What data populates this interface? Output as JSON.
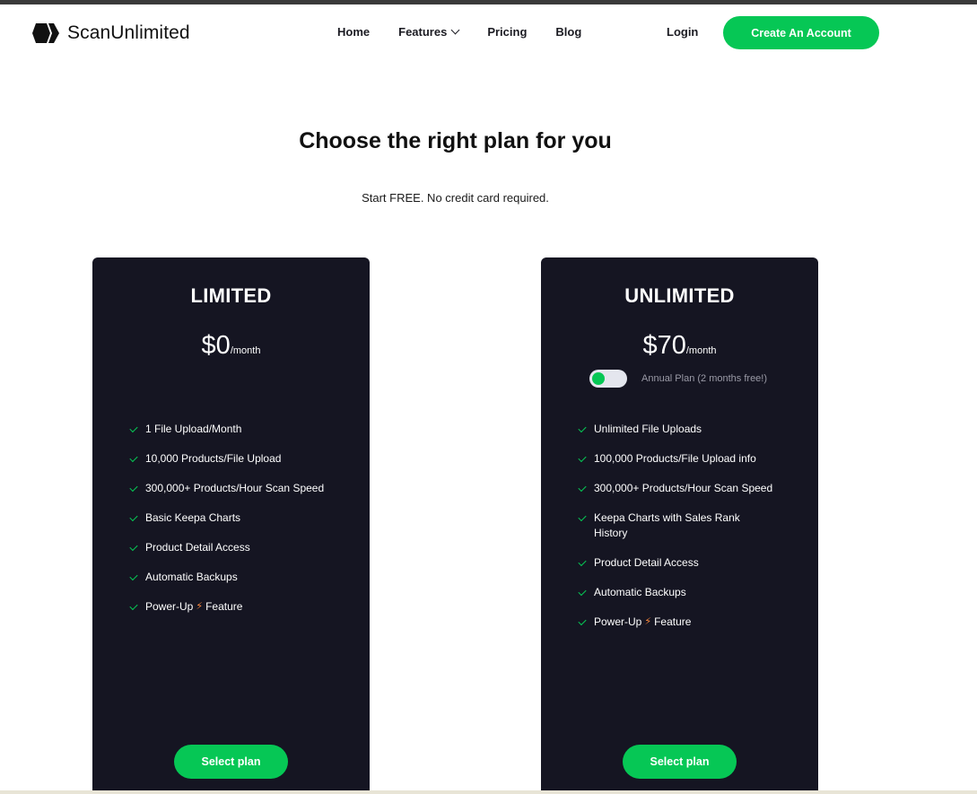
{
  "header": {
    "logo_text": "ScanUnlimited",
    "nav": [
      {
        "label": "Home"
      },
      {
        "label": "Features"
      },
      {
        "label": "Pricing"
      },
      {
        "label": "Blog"
      }
    ],
    "login_label": "Login",
    "cta_label": "Create An Account"
  },
  "hero": {
    "title": "Choose the right plan for you",
    "subtitle": "Start FREE. No credit card required."
  },
  "plans": [
    {
      "name": "LIMITED",
      "price": "$0",
      "period": "/month",
      "features": [
        "1 File Upload/Month",
        "10,000 Products/File Upload",
        "300,000+ Products/Hour Scan Speed",
        "Basic Keepa Charts",
        "Product Detail Access",
        "Automatic Backups",
        "Power-Up",
        "Feature"
      ],
      "button_label": "Select plan"
    },
    {
      "name": "UNLIMITED",
      "price": "$70",
      "period": "/month",
      "toggle_label": "Annual Plan (2 months free!)",
      "features": [
        "Unlimited File Uploads",
        "100,000 Products/File Upload info",
        "300,000+ Products/Hour Scan Speed",
        "Keepa Charts with Sales Rank History",
        "Product Detail Access",
        "Automatic Backups",
        "Power-Up",
        "Feature"
      ],
      "button_label": "Select plan"
    }
  ],
  "colors": {
    "accent": "#06c755",
    "card_bg": "#151522",
    "bolt": "#ff8a3d"
  },
  "icons": {
    "logo": "hexagon-chevron-logo-icon",
    "check": "check-icon",
    "bolt": "lightning-bolt-icon",
    "nav_dropdown": "chevron-down-icon"
  }
}
